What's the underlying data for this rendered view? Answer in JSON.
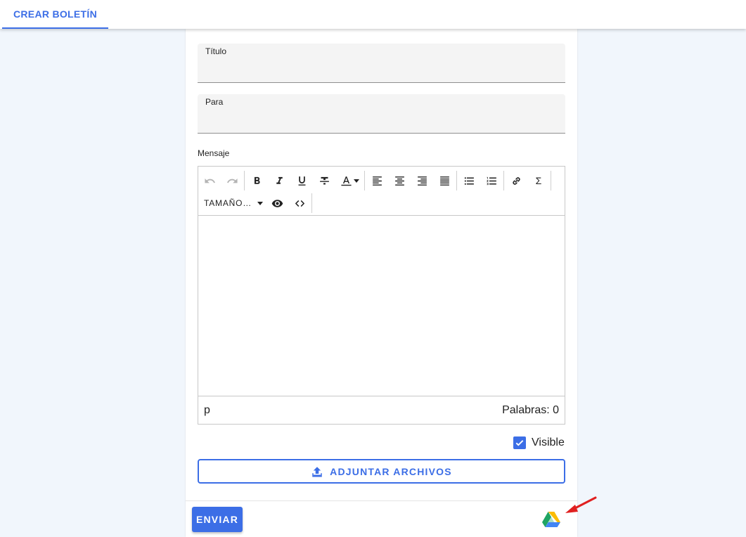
{
  "header": {
    "tab_label": "CREAR BOLETÍN"
  },
  "form": {
    "title_label": "Título",
    "title_value": "",
    "to_label": "Para",
    "to_value": "",
    "message_label": "Mensaje"
  },
  "editor": {
    "size_label": "TAMAÑO…",
    "status_tag": "p",
    "word_count": "Palabras: 0",
    "sigma": "Σ"
  },
  "visible": {
    "label": "Visible",
    "checked": true
  },
  "attach_label": "ADJUNTAR ARCHIVOS",
  "send_label": "ENVIAR",
  "colors": {
    "accent": "#3c6ee6",
    "annotation_arrow": "#e02020"
  }
}
